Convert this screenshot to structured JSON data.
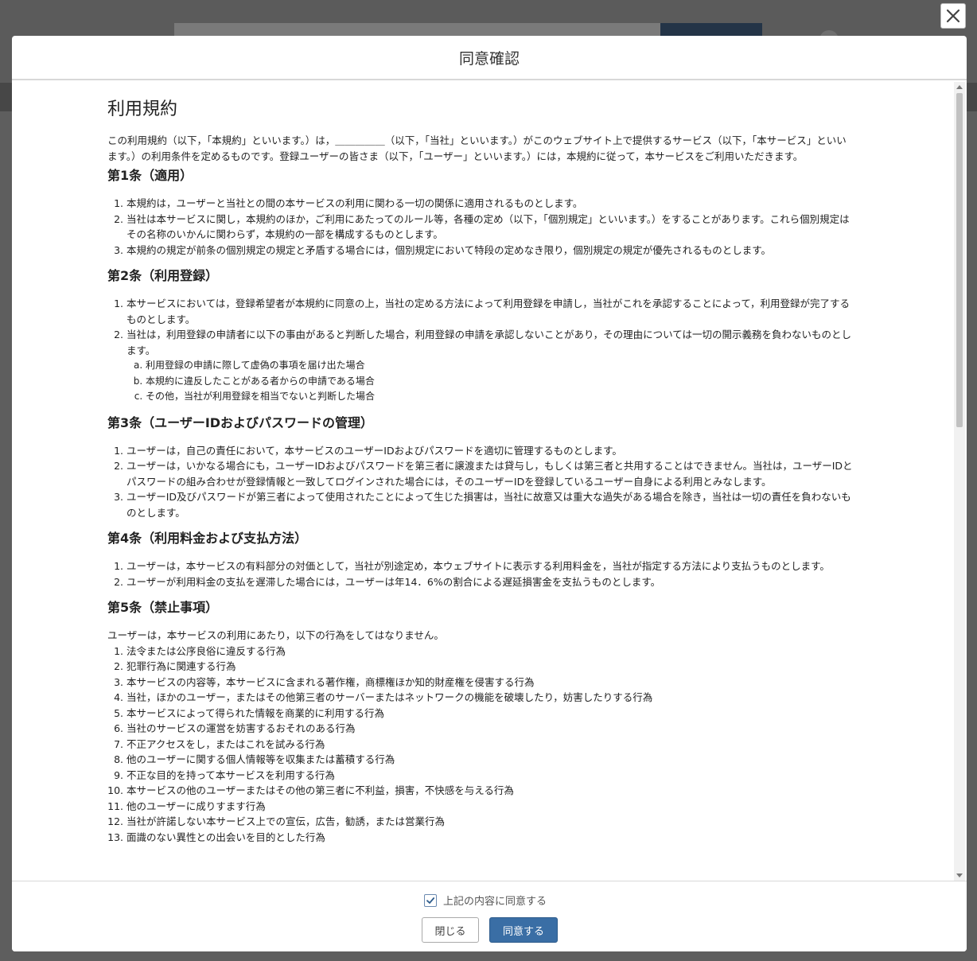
{
  "modal": {
    "title": "同意確認"
  },
  "doc": {
    "title": "利用規約",
    "intro": "この利用規約（以下，「本規約」といいます。）は，＿＿＿＿＿（以下，「当社」といいます。）がこのウェブサイト上で提供するサービス（以下，「本サービス」といいます。）の利用条件を定めるものです。登録ユーザーの皆さま（以下，「ユーザー」といいます。）には，本規約に従って，本サービスをご利用いただきます。",
    "a1": {
      "heading": "第1条（適用）",
      "items": [
        "本規約は，ユーザーと当社との間の本サービスの利用に関わる一切の関係に適用されるものとします。",
        "当社は本サービスに関し，本規約のほか，ご利用にあたってのルール等，各種の定め（以下，「個別規定」といいます。）をすることがあります。これら個別規定はその名称のいかんに関わらず，本規約の一部を構成するものとします。",
        "本規約の規定が前条の個別規定の規定と矛盾する場合には，個別規定において特段の定めなき限り，個別規定の規定が優先されるものとします。"
      ]
    },
    "a2": {
      "heading": "第2条（利用登録）",
      "items": [
        "本サービスにおいては，登録希望者が本規約に同意の上，当社の定める方法によって利用登録を申請し，当社がこれを承認することによって，利用登録が完了するものとします。",
        "当社は，利用登録の申請者に以下の事由があると判断した場合，利用登録の申請を承認しないことがあり，その理由については一切の開示義務を負わないものとします。"
      ],
      "sub": [
        "利用登録の申請に際して虚偽の事項を届け出た場合",
        "本規約に違反したことがある者からの申請である場合",
        "その他，当社が利用登録を相当でないと判断した場合"
      ]
    },
    "a3": {
      "heading": "第3条（ユーザーIDおよびパスワードの管理）",
      "items": [
        "ユーザーは，自己の責任において，本サービスのユーザーIDおよびパスワードを適切に管理するものとします。",
        "ユーザーは，いかなる場合にも，ユーザーIDおよびパスワードを第三者に譲渡または貸与し，もしくは第三者と共用することはできません。当社は，ユーザーIDとパスワードの組み合わせが登録情報と一致してログインされた場合には，そのユーザーIDを登録しているユーザー自身による利用とみなします。",
        "ユーザーID及びパスワードが第三者によって使用されたことによって生じた損害は，当社に故意又は重大な過失がある場合を除き，当社は一切の責任を負わないものとします。"
      ]
    },
    "a4": {
      "heading": "第4条（利用料金および支払方法）",
      "items": [
        "ユーザーは，本サービスの有料部分の対価として，当社が別途定め，本ウェブサイトに表示する利用料金を，当社が指定する方法により支払うものとします。",
        "ユーザーが利用料金の支払を遅滞した場合には，ユーザーは年14．6%の割合による遅延損害金を支払うものとします。"
      ]
    },
    "a5": {
      "heading": "第5条（禁止事項）",
      "intro": "ユーザーは，本サービスの利用にあたり，以下の行為をしてはなりません。",
      "items": [
        "法令または公序良俗に違反する行為",
        "犯罪行為に関連する行為",
        "本サービスの内容等，本サービスに含まれる著作権，商標権ほか知的財産権を侵害する行為",
        "当社，ほかのユーザー，またはその他第三者のサーバーまたはネットワークの機能を破壊したり，妨害したりする行為",
        "本サービスによって得られた情報を商業的に利用する行為",
        "当社のサービスの運営を妨害するおそれのある行為",
        "不正アクセスをし，またはこれを試みる行為",
        "他のユーザーに関する個人情報等を収集または蓄積する行為",
        "不正な目的を持って本サービスを利用する行為",
        "本サービスの他のユーザーまたはその他の第三者に不利益，損害，不快感を与える行為",
        "他のユーザーに成りすます行為",
        "当社が許諾しない本サービス上での宣伝，広告，勧誘，または営業行為",
        "面識のない異性との出会いを目的とした行為"
      ]
    }
  },
  "footer": {
    "agree_label": "上記の内容に同意する",
    "agree_checked": true,
    "close_label": "閉じる",
    "agree_button_label": "同意する"
  },
  "colors": {
    "primary": "#3a6ea5",
    "overlay": "#5a5a5a"
  }
}
